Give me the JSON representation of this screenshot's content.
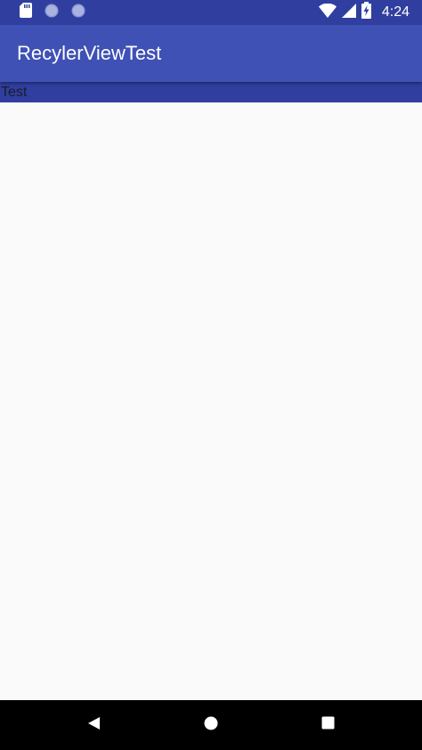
{
  "status_bar": {
    "time": "4:24",
    "icons": [
      "sd-card-icon",
      "notification-dot-icon",
      "notification-dot-icon",
      "wifi-icon",
      "cellular-signal-icon",
      "battery-charging-icon"
    ]
  },
  "app_bar": {
    "title": "RecylerViewTest"
  },
  "recycler_view": {
    "items": [
      {
        "text": "Test"
      }
    ]
  },
  "nav_bar": {
    "buttons": [
      "back-icon",
      "home-icon",
      "recents-icon"
    ]
  },
  "colors": {
    "primary": "#3f51b5",
    "primary_dark": "#303f9f",
    "background": "#fafafa",
    "nav_bar": "#000000"
  }
}
